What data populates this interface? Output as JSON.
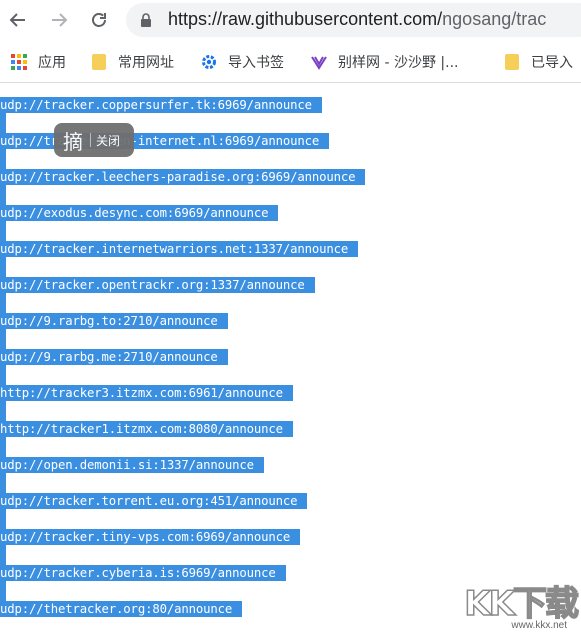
{
  "browser": {
    "url_host": "https://raw.githubusercontent.com/",
    "url_path": "ngosang/trac"
  },
  "bookmarks": [
    {
      "label": "应用",
      "icon": "apps-grid-icon"
    },
    {
      "label": "常用网址",
      "icon": "folder-icon"
    },
    {
      "label": "导入书签",
      "icon": "gear-icon"
    },
    {
      "label": "别样网 - 沙沙野 |...",
      "icon": "site-logo-icon"
    },
    {
      "label": "已导入",
      "icon": "folder-icon"
    }
  ],
  "trackers": [
    "udp://tracker.coppersurfer.tk:6969/announce",
    "udp://tracker.open-internet.nl:6969/announce",
    "udp://tracker.leechers-paradise.org:6969/announce",
    "udp://exodus.desync.com:6969/announce",
    "udp://tracker.internetwarriors.net:1337/announce",
    "udp://tracker.opentrackr.org:1337/announce",
    "udp://9.rarbg.to:2710/announce",
    "udp://9.rarbg.me:2710/announce",
    "http://tracker3.itzmx.com:6961/announce",
    "http://tracker1.itzmx.com:8080/announce",
    "udp://open.demonii.si:1337/announce",
    "udp://tracker.torrent.eu.org:451/announce",
    "udp://tracker.tiny-vps.com:6969/announce",
    "udp://tracker.cyberia.is:6969/announce",
    "udp://thetracker.org:80/announce"
  ],
  "popup": {
    "icon_char": "摘",
    "close_label": "关闭"
  },
  "watermark": {
    "brand": "KK下载",
    "url": "www.kkx.net"
  },
  "colors": {
    "selection": "#3b8fe0",
    "omnibox": "#f1f3f4"
  }
}
